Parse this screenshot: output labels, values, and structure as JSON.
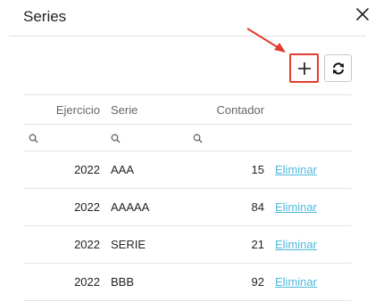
{
  "dialog": {
    "title": "Series",
    "close_icon": "close-icon"
  },
  "toolbar": {
    "add_icon": "plus-icon",
    "refresh_icon": "refresh-icon",
    "highlight_color": "#e53a2e"
  },
  "table": {
    "columns": [
      "Ejercicio",
      "Serie",
      "Contador",
      ""
    ],
    "filter_icon": "search-icon",
    "rows": [
      {
        "ejercicio": "2022",
        "serie": "AAA",
        "contador": "15",
        "action": "Eliminar"
      },
      {
        "ejercicio": "2022",
        "serie": "AAAAA",
        "contador": "84",
        "action": "Eliminar"
      },
      {
        "ejercicio": "2022",
        "serie": "SERIE",
        "contador": "21",
        "action": "Eliminar"
      },
      {
        "ejercicio": "2022",
        "serie": "BBB",
        "contador": "92",
        "action": "Eliminar"
      }
    ],
    "link_color": "#4fb8dd"
  }
}
